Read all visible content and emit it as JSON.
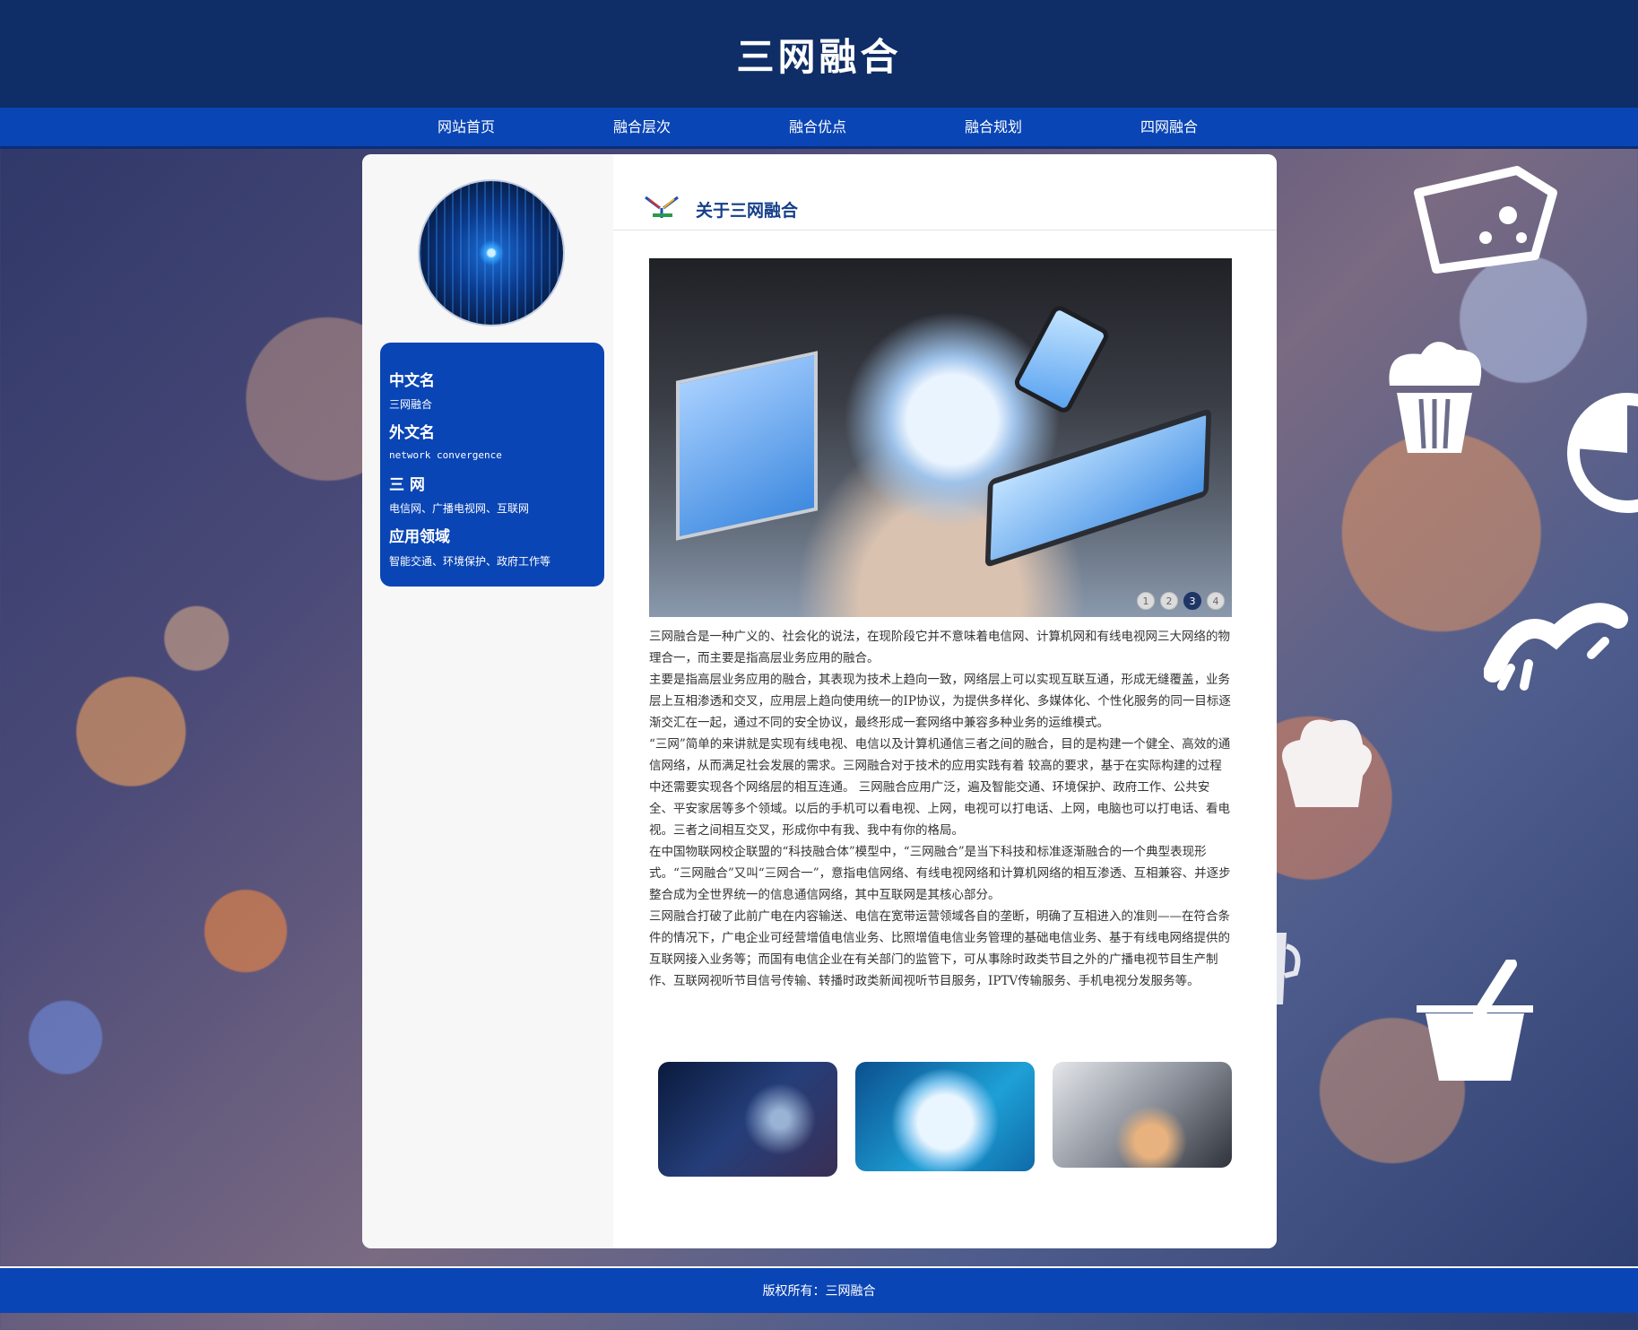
{
  "site": {
    "title": "三网融合"
  },
  "nav": {
    "items": [
      "网站首页",
      "融合层次",
      "融合优点",
      "融合规划",
      "四网融合"
    ]
  },
  "sidebar": {
    "fields": [
      {
        "label": "中文名",
        "value": "三网融合"
      },
      {
        "label": "外文名",
        "value": "network convergence"
      },
      {
        "label": "三 网",
        "value": "电信网、广播电视网、互联网"
      },
      {
        "label": "应用领域",
        "value": "智能交通、环境保护、政府工作等"
      }
    ]
  },
  "main": {
    "section_title": "关于三网融合",
    "slider": {
      "dots": [
        "1",
        "2",
        "3",
        "4"
      ],
      "active": 3
    },
    "paragraphs": [
      "三网融合是一种广义的、社会化的说法，在现阶段它并不意味着电信网、计算机网和有线电视网三大网络的物理合一，而主要是指高层业务应用的融合。",
      "主要是指高层业务应用的融合，其表现为技术上趋向一致，网络层上可以实现互联互通，形成无缝覆盖，业务层上互相渗透和交叉，应用层上趋向使用统一的IP协议，为提供多样化、多媒体化、个性化服务的同一目标逐渐交汇在一起，通过不同的安全协议，最终形成一套网络中兼容多种业务的运维模式。",
      "“三网”简单的来讲就是实现有线电视、电信以及计算机通信三者之间的融合，目的是构建一个健全、高效的通信网络，从而满足社会发展的需求。三网融合对于技术的应用实践有着 较高的要求，基于在实际构建的过程中还需要实现各个网络层的相互连通。 三网融合应用广泛，遍及智能交通、环境保护、政府工作、公共安全、平安家居等多个领域。以后的手机可以看电视、上网，电视可以打电话、上网，电脑也可以打电话、看电视。三者之间相互交叉，形成你中有我、我中有你的格局。",
      "在中国物联网校企联盟的“科技融合体”模型中，“三网融合”是当下科技和标准逐渐融合的一个典型表现形式。“三网融合”又叫“三网合一”，意指电信网络、有线电视网络和计算机网络的相互渗透、互相兼容、并逐步整合成为全世界统一的信息通信网络，其中互联网是其核心部分。",
      "三网融合打破了此前广电在内容输送、电信在宽带运营领域各自的垄断，明确了互相进入的准则——在符合条件的情况下，广电企业可经营增值电信业务、比照增值电信业务管理的基础电信业务、基于有线电网络提供的互联网接入业务等；而国有电信企业在有关部门的监管下，可从事除时政类节目之外的广播电视节目生产制作、互联网视听节目信号传输、转播时政类新闻视听节目服务，IPTV传输服务、手机电视分发服务等。"
    ]
  },
  "footer": {
    "copyright": "版权所有：三网融合"
  },
  "colors": {
    "header_bg": "#0f2d66",
    "nav_bg": "#0a45b5",
    "info_box_bg": "#0a45b5",
    "title_text": "#153f8a"
  },
  "icons": [
    "cheese-icon",
    "cupcake-icon",
    "pie-chart-icon",
    "croissant-icon",
    "chef-hat-icon",
    "coffee-cup-icon",
    "champagne-bucket-icon",
    "logo-icon"
  ]
}
